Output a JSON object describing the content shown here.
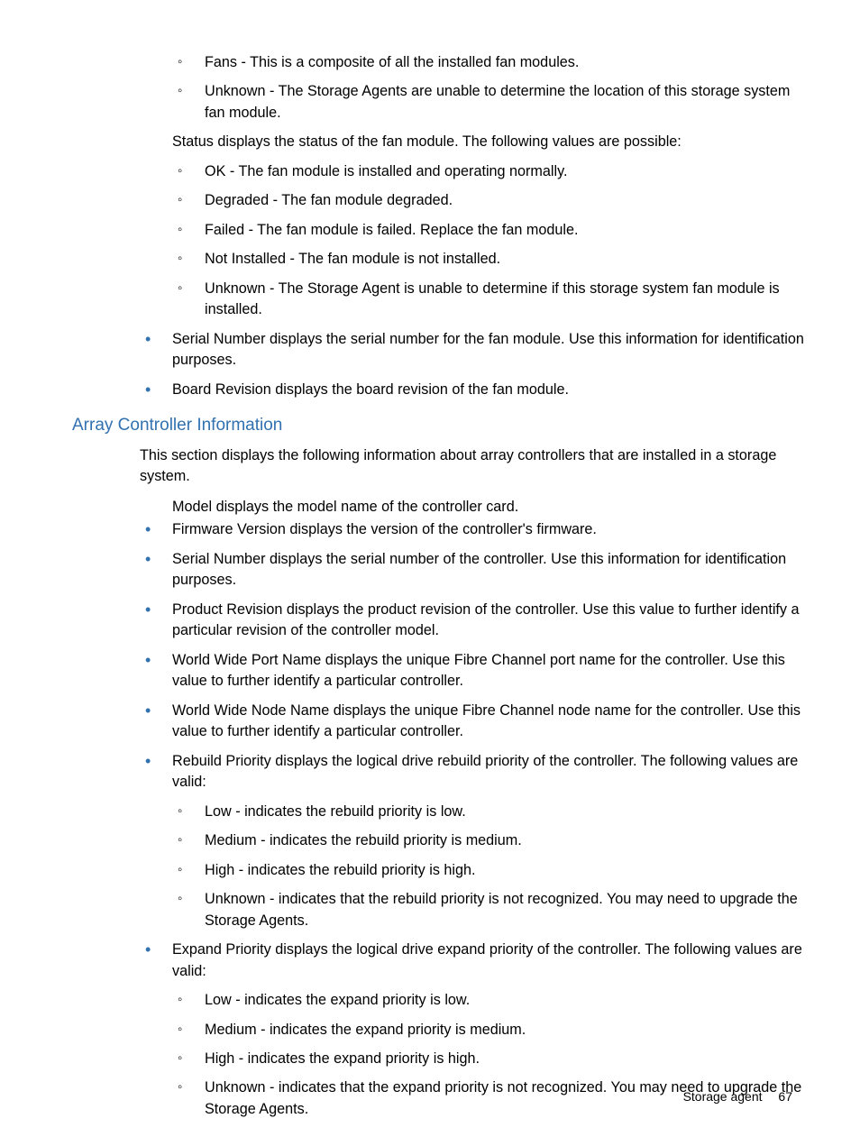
{
  "top": {
    "location_values": [
      "Fans - This is a composite of all the installed fan modules.",
      "Unknown - The Storage Agents are unable to determine the location of this storage system fan module."
    ],
    "status_intro": "Status displays the status of the fan module. The following values are possible:",
    "status_values": [
      "OK - The fan module is installed and operating normally.",
      "Degraded - The fan module degraded.",
      "Failed - The fan module is failed. Replace the fan module.",
      "Not Installed - The fan module is not installed.",
      "Unknown - The Storage Agent is unable to determine if this storage system fan module is installed."
    ],
    "serial": "Serial Number displays the serial number for the fan module. Use this information for identification purposes.",
    "board": "Board Revision displays the board revision of the fan module."
  },
  "section": {
    "heading": "Array Controller Information",
    "intro": "This section displays the following information about array controllers that are installed in a storage system.",
    "items": {
      "model": "Model displays the model name of the controller card.",
      "firmware": "Firmware Version displays the version of the controller's firmware.",
      "serial": "Serial Number displays the serial number of the controller. Use this information for identification purposes.",
      "product_rev": "Product Revision displays the product revision of the controller. Use this value to further identify a particular revision of the controller model.",
      "wwpn": "World Wide Port Name displays the unique Fibre Channel port name for the controller. Use this value to further identify a particular controller.",
      "wwnn": "World Wide Node Name displays the unique Fibre Channel node name for the controller. Use this value to further identify a particular controller.",
      "rebuild_intro": "Rebuild Priority displays the logical drive rebuild priority of the controller. The following values are valid:",
      "rebuild_values": [
        "Low - indicates the rebuild priority is low.",
        "Medium - indicates the rebuild priority is medium.",
        "High - indicates the rebuild priority is high.",
        "Unknown - indicates that the rebuild priority is not recognized. You may need to upgrade the Storage Agents."
      ],
      "expand_intro": "Expand Priority displays the logical drive expand priority of the controller. The following values are valid:",
      "expand_values": [
        "Low - indicates the expand priority is low.",
        "Medium - indicates the expand priority is medium.",
        "High - indicates the expand priority is high.",
        "Unknown - indicates that the expand priority is not recognized. You may need to upgrade the Storage Agents."
      ]
    }
  },
  "footer": {
    "label": "Storage agent",
    "page": "67"
  }
}
